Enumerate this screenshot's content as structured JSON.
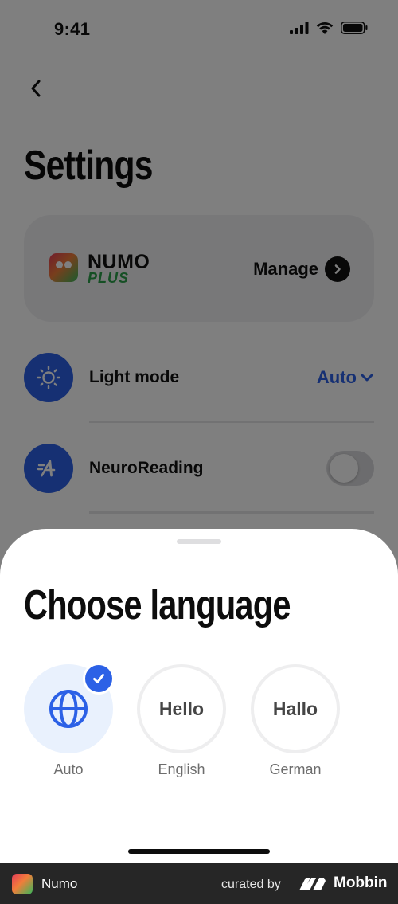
{
  "status_bar": {
    "time": "9:41"
  },
  "settings": {
    "title": "Settings",
    "plus_card": {
      "brand_name": "NUMO",
      "brand_tier": "PLUS",
      "manage_label": "Manage"
    },
    "rows": [
      {
        "label": "Light mode",
        "value": "Auto"
      },
      {
        "label": "NeuroReading",
        "enabled": false
      }
    ]
  },
  "language_sheet": {
    "title": "Choose language",
    "options": [
      {
        "label": "Auto",
        "preview": "",
        "selected": true
      },
      {
        "label": "English",
        "preview": "Hello",
        "selected": false
      },
      {
        "label": "German",
        "preview": "Hallo",
        "selected": false
      }
    ]
  },
  "footer": {
    "app_name": "Numo",
    "curated_by": "curated by",
    "brand": "Mobbin"
  },
  "colors": {
    "accent": "#2c61e6",
    "plus_green": "#2a9f48",
    "scrim": "rgba(0,0,0,0.5)"
  }
}
